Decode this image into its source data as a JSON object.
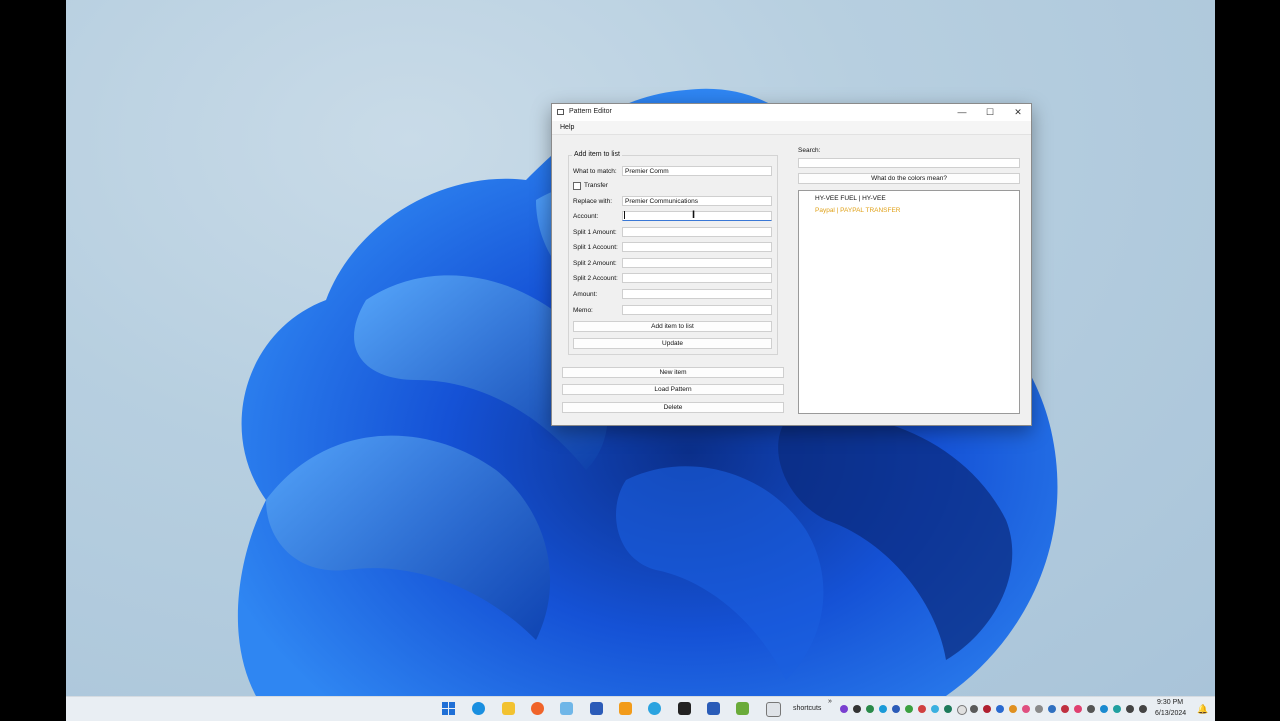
{
  "window": {
    "title": "Pattern Editor",
    "controls": {
      "minimize": "—",
      "maximize": "☐",
      "close": "✕"
    }
  },
  "menu": {
    "help": "Help"
  },
  "form": {
    "group_title": "Add item to list",
    "what_to_match": {
      "label": "What to match:",
      "value": "Premier Comm"
    },
    "transfer": {
      "label": "Transfer",
      "checked": false
    },
    "replace_with": {
      "label": "Replace with:",
      "value": "Premier Communications"
    },
    "account": {
      "label": "Account:",
      "value": ""
    },
    "split1_amount": {
      "label": "Split 1 Amount:",
      "value": ""
    },
    "split1_account": {
      "label": "Split 1 Account:",
      "value": ""
    },
    "split2_amount": {
      "label": "Split 2 Amount:",
      "value": ""
    },
    "split2_account": {
      "label": "Split 2 Account:",
      "value": ""
    },
    "amount": {
      "label": "Amount:",
      "value": ""
    },
    "memo": {
      "label": "Memo:",
      "value": ""
    },
    "add_button": "Add item to list",
    "update_button": "Update"
  },
  "actions": {
    "new_item": "New item",
    "load_pattern": "Load Pattern",
    "delete": "Delete"
  },
  "search": {
    "label": "Search:",
    "colors_button": "What do the colors mean?"
  },
  "patterns": [
    {
      "text": "HY-VEE FUEL | HY-VEE",
      "color": "#111111"
    },
    {
      "text": "Paypal | PAYPAL TRANSFER",
      "color": "#e0a21a"
    }
  ],
  "taskbar": {
    "shortcuts_label": "shortcuts",
    "overflow": "»",
    "time": "9:30 PM",
    "date": "6/13/2024",
    "icons": [
      "windows-start-icon",
      "cortana-icon",
      "file-explorer-icon",
      "firefox-icon",
      "snipping-icon",
      "paint-icon",
      "vlc-icon",
      "telegram-icon",
      "notepad-icon",
      "word-icon",
      "sketch-icon",
      "window-icon"
    ]
  }
}
